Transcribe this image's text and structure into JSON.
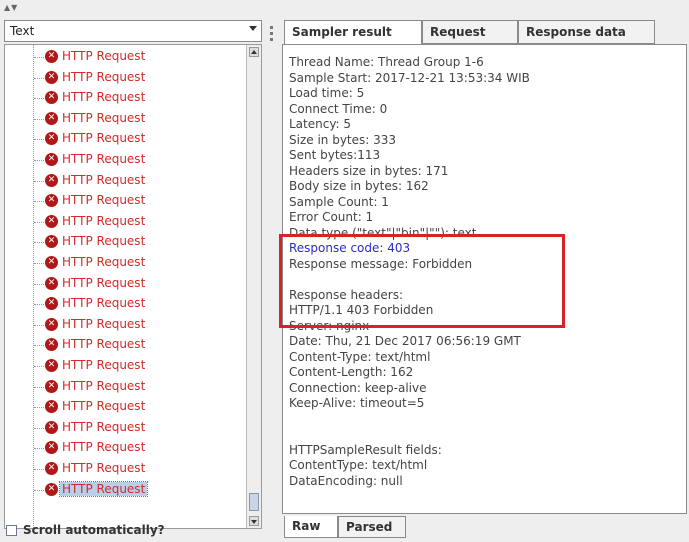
{
  "tree_panel": {
    "combo_label": "Text",
    "items": [
      {
        "label": "HTTP Request"
      },
      {
        "label": "HTTP Request"
      },
      {
        "label": "HTTP Request"
      },
      {
        "label": "HTTP Request"
      },
      {
        "label": "HTTP Request"
      },
      {
        "label": "HTTP Request"
      },
      {
        "label": "HTTP Request"
      },
      {
        "label": "HTTP Request"
      },
      {
        "label": "HTTP Request"
      },
      {
        "label": "HTTP Request"
      },
      {
        "label": "HTTP Request"
      },
      {
        "label": "HTTP Request"
      },
      {
        "label": "HTTP Request"
      },
      {
        "label": "HTTP Request"
      },
      {
        "label": "HTTP Request"
      },
      {
        "label": "HTTP Request"
      },
      {
        "label": "HTTP Request"
      },
      {
        "label": "HTTP Request"
      },
      {
        "label": "HTTP Request"
      },
      {
        "label": "HTTP Request"
      },
      {
        "label": "HTTP Request"
      },
      {
        "label": "HTTP Request",
        "selected": true
      }
    ],
    "status_icon": "error-x-icon",
    "scroll_auto_label": "Scroll automatically?"
  },
  "tabs": [
    {
      "label": "Sampler result",
      "active": true
    },
    {
      "label": "Request"
    },
    {
      "label": "Response data"
    }
  ],
  "result_lines": [
    {
      "text": "Thread Name: Thread Group 1-6"
    },
    {
      "text": "Sample Start: 2017-12-21 13:53:34 WIB"
    },
    {
      "text": "Load time: 5"
    },
    {
      "text": "Connect Time: 0"
    },
    {
      "text": "Latency: 5"
    },
    {
      "text": "Size in bytes: 333"
    },
    {
      "text": "Sent bytes:113"
    },
    {
      "text": "Headers size in bytes: 171"
    },
    {
      "text": "Body size in bytes: 162"
    },
    {
      "text": "Sample Count: 1"
    },
    {
      "text": "Error Count: 1"
    },
    {
      "text": "Data type (\"text\"|\"bin\"|\"\"): text"
    },
    {
      "text": "Response code: 403",
      "color": "#2a2ad0"
    },
    {
      "text": "Response message: Forbidden"
    },
    {
      "text": ""
    },
    {
      "text": "Response headers:"
    },
    {
      "text": "HTTP/1.1 403 Forbidden"
    },
    {
      "text": "Server: nginx"
    },
    {
      "text": "Date: Thu, 21 Dec 2017 06:56:19 GMT"
    },
    {
      "text": "Content-Type: text/html"
    },
    {
      "text": "Content-Length: 162"
    },
    {
      "text": "Connection: keep-alive"
    },
    {
      "text": "Keep-Alive: timeout=5"
    },
    {
      "text": ""
    },
    {
      "text": ""
    },
    {
      "text": "HTTPSampleResult fields:"
    },
    {
      "text": "ContentType: text/html"
    },
    {
      "text": "DataEncoding: null"
    }
  ],
  "bottom_tabs": [
    {
      "label": "Raw",
      "active": true
    },
    {
      "label": "Parsed"
    }
  ],
  "colors": {
    "error_text": "#d42a2a",
    "highlight_box": "#d4232d",
    "response_code": "#2a2ad0"
  }
}
